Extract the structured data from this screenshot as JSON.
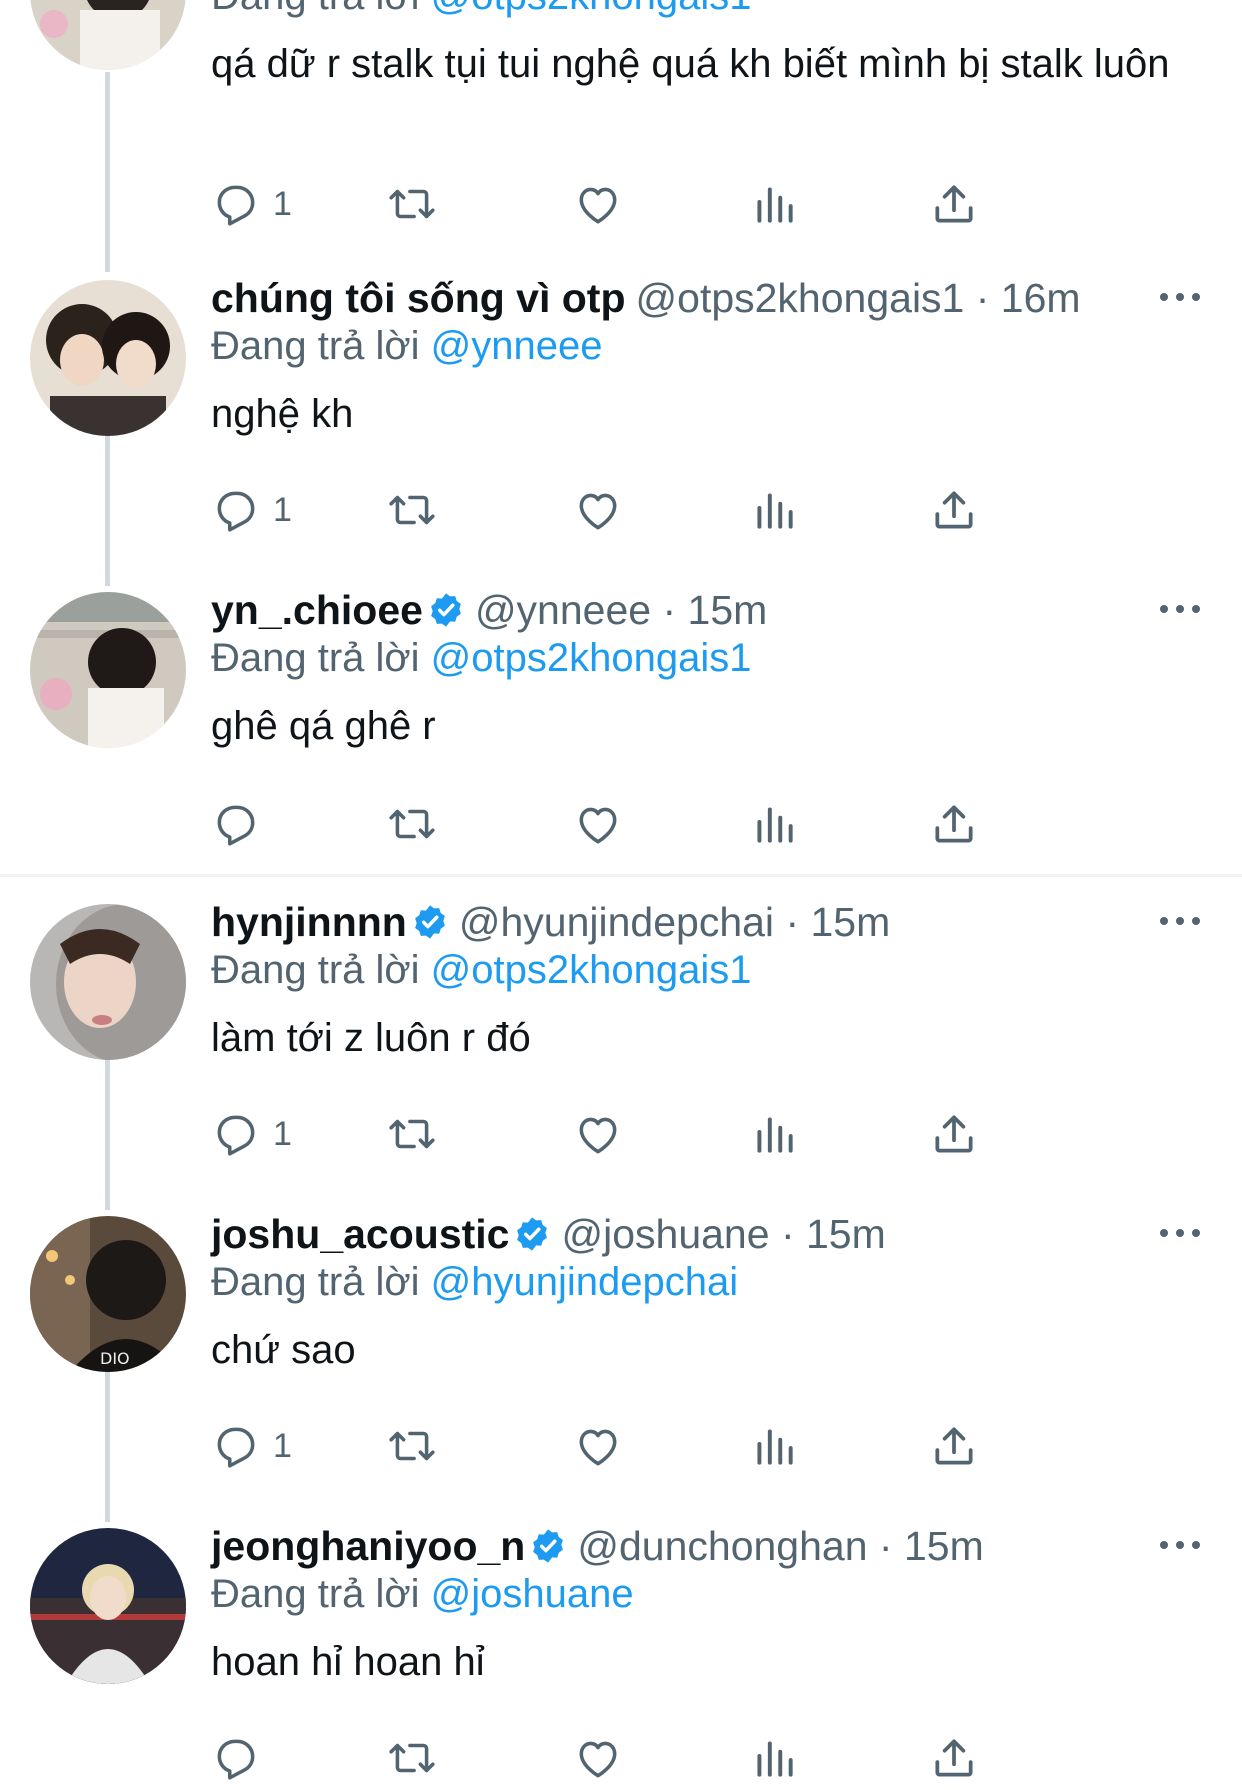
{
  "icons": {
    "reply": "reply-icon",
    "retweet": "retweet-icon",
    "like": "heart-icon",
    "views": "views-icon",
    "share": "share-icon",
    "more": "more-icon",
    "verified": "verified-badge-icon"
  },
  "colors": {
    "accent": "#1d9bf0",
    "secondary_text": "#536471",
    "thread_line": "#cfd9de"
  },
  "reply_prefix": "Đang trả lời",
  "tweets": [
    {
      "display_name": "",
      "handle": "",
      "time": "",
      "reply_to": "@otps2khongais1",
      "text": "qá dữ r stalk tụi tui nghệ quá kh biết mình bị stalk luôn",
      "reply_count": "1"
    },
    {
      "display_name": "chúng tôi sống vì otp",
      "handle": "@otps2khongais1",
      "time": "· 16m",
      "reply_to": "@ynneee",
      "text": "nghệ kh",
      "reply_count": "1"
    },
    {
      "display_name": "yn_.chioee",
      "handle": "@ynneee",
      "time": "· 15m",
      "reply_to": "@otps2khongais1",
      "text": "ghê qá ghê r",
      "reply_count": ""
    },
    {
      "display_name": "hynjinnnn",
      "handle": "@hyunjindepchai",
      "time": "· 15m",
      "reply_to": "@otps2khongais1",
      "text": "làm tới z luôn r đó",
      "reply_count": "1"
    },
    {
      "display_name": "joshu_acoustic",
      "handle": "@joshuane",
      "time": "· 15m",
      "reply_to": "@hyunjindepchai",
      "text": "chứ sao",
      "reply_count": "1"
    },
    {
      "display_name": "jeonghaniyoo_n",
      "handle": "@dunchonghan",
      "time": "· 15m",
      "reply_to": "@joshuane",
      "text": "hoan hỉ hoan hỉ",
      "reply_count": ""
    }
  ]
}
